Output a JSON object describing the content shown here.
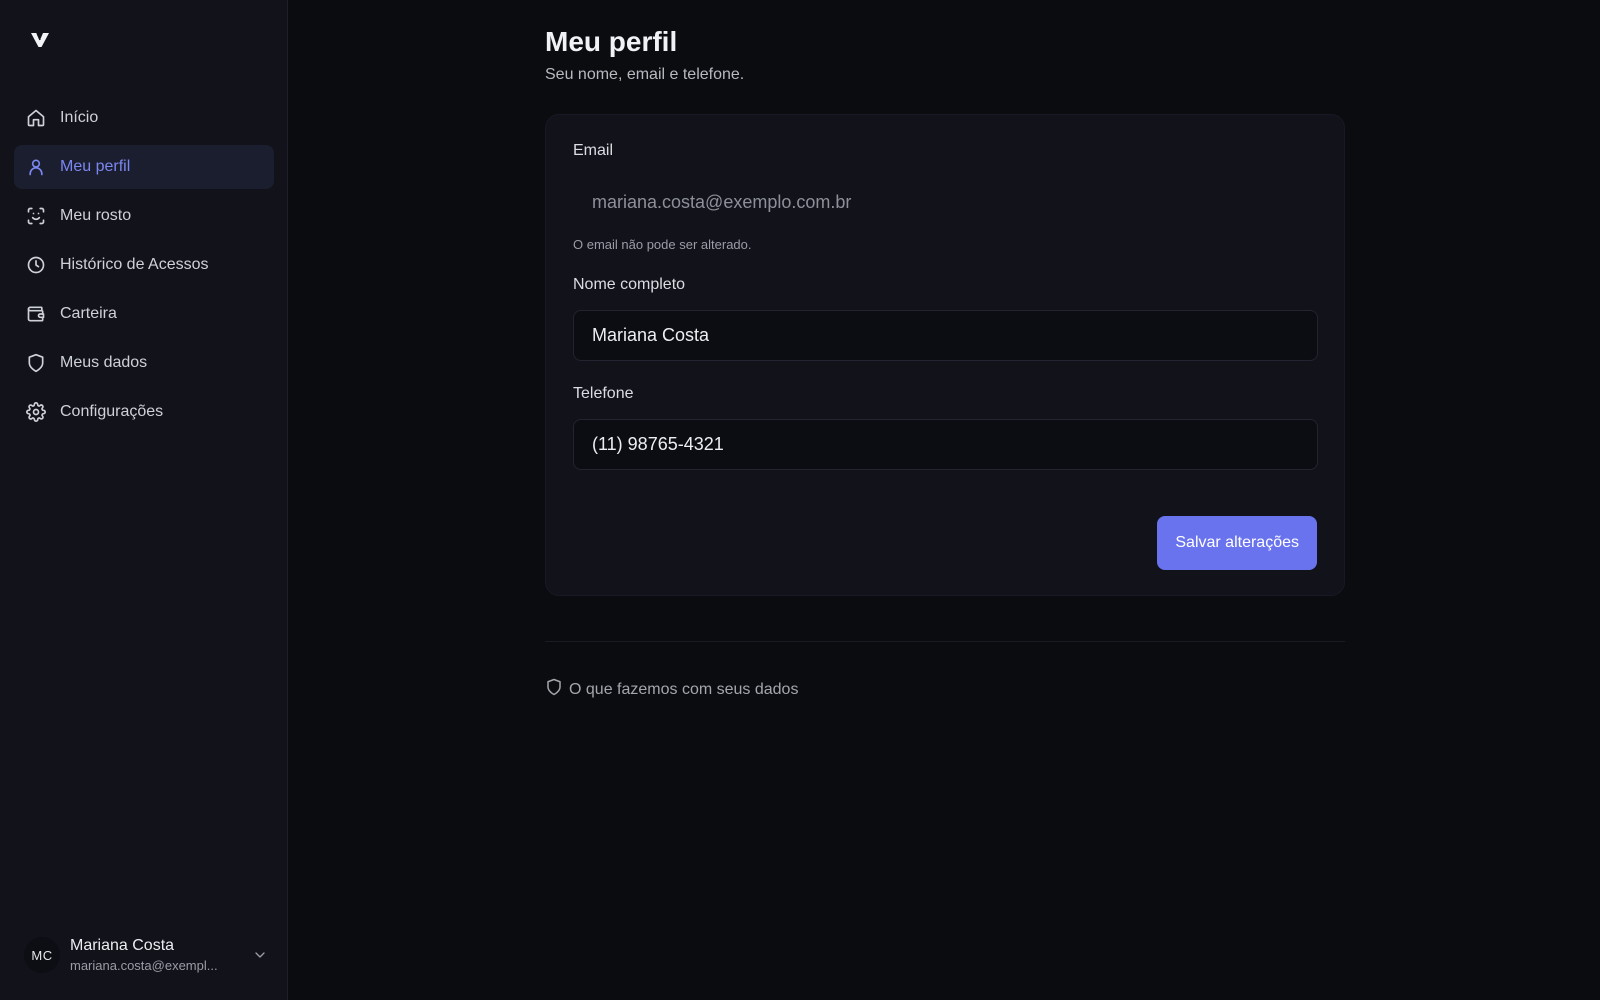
{
  "sidebar": {
    "logo_icon": "v-logo-icon",
    "items": [
      {
        "label": "Início",
        "icon": "home-icon",
        "active": false
      },
      {
        "label": "Meu perfil",
        "icon": "user-icon",
        "active": true
      },
      {
        "label": "Meu rosto",
        "icon": "face-scan-icon",
        "active": false
      },
      {
        "label": "Histórico de Acessos",
        "icon": "clock-icon",
        "active": false
      },
      {
        "label": "Carteira",
        "icon": "wallet-icon",
        "active": false
      },
      {
        "label": "Meus dados",
        "icon": "shield-icon",
        "active": false
      },
      {
        "label": "Configurações",
        "icon": "gear-icon",
        "active": false
      }
    ],
    "user": {
      "initials": "MC",
      "name": "Mariana Costa",
      "email": "mariana.costa@exempl..."
    }
  },
  "main": {
    "title": "Meu perfil",
    "subtitle": "Seu nome, email e telefone.",
    "form": {
      "email_label": "Email",
      "email_value": "mariana.costa@exemplo.com.br",
      "email_hint": "O email não pode ser alterado.",
      "name_label": "Nome completo",
      "name_value": "Mariana Costa",
      "phone_label": "Telefone",
      "phone_value": "(11) 98765-4321",
      "save_label": "Salvar alterações"
    },
    "data_link": "O que fazemos com seus dados"
  },
  "colors": {
    "accent": "#6a73ee",
    "active_nav_text": "#7b87f0",
    "background": "#0b0c10",
    "sidebar": "#11121a"
  }
}
